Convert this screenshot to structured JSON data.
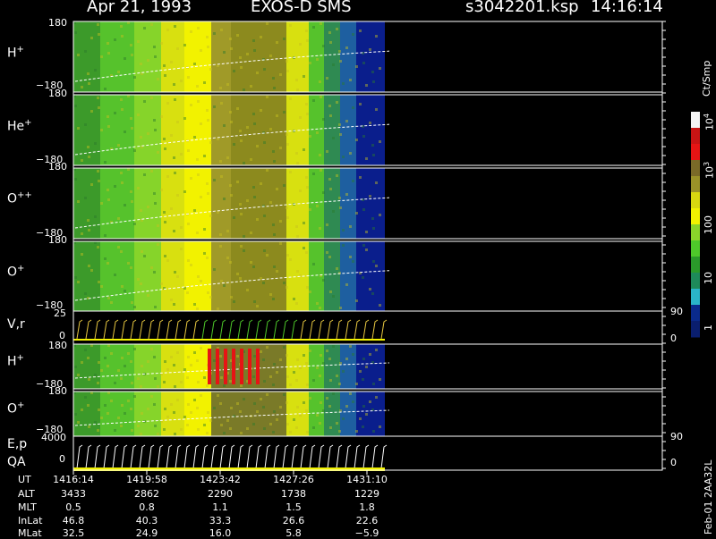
{
  "header": {
    "date": "Apr 21, 1993",
    "instrument": "EXOS-D SMS",
    "file": "s3042201.ksp",
    "time": "14:16:14"
  },
  "chart_data": {
    "type": "heatmap",
    "time_range": [
      "1416:14",
      "1431:10"
    ],
    "panels": [
      {
        "label": "H",
        "charge": "+",
        "ymax": "180",
        "ymin": "−180"
      },
      {
        "label": "He",
        "charge": "+",
        "ymax": "180",
        "ymin": "−180"
      },
      {
        "label": "O",
        "charge": "++",
        "ymax": "180",
        "ymin": "−180"
      },
      {
        "label": "O",
        "charge": "+",
        "ymax": "180",
        "ymin": "−180"
      },
      {
        "label": "V,r",
        "charge": "",
        "ymax": "25",
        "ymin": "0",
        "right_max": "90",
        "right_min": "0"
      },
      {
        "label": "H",
        "charge": "+",
        "ymax": "180",
        "ymin": "−180"
      },
      {
        "label": "O",
        "charge": "+",
        "ymax": "180",
        "ymin": "−180"
      },
      {
        "label": "E,p",
        "label2": "QA",
        "charge": "",
        "ymax": "4000",
        "ymin": "0",
        "right_max": "90",
        "right_min": "0"
      }
    ],
    "colorbar": {
      "unit": "Ct/Smp",
      "ticks": [
        "1",
        "10",
        "100",
        "10",
        "10"
      ],
      "tick_exps": [
        "",
        "",
        "",
        "3",
        "4"
      ]
    },
    "ephemeris": {
      "rows": [
        {
          "name": "UT",
          "values": [
            "1416:14",
            "1419:58",
            "1423:42",
            "1427:26",
            "1431:10"
          ]
        },
        {
          "name": "ALT",
          "values": [
            "3433",
            "2862",
            "2290",
            "1738",
            "1229"
          ]
        },
        {
          "name": "MLT",
          "values": [
            "0.5",
            "0.8",
            "1.1",
            "1.5",
            "1.8"
          ]
        },
        {
          "name": "InLat",
          "values": [
            "46.8",
            "40.3",
            "33.3",
            "26.6",
            "22.6"
          ]
        },
        {
          "name": "MLat",
          "values": [
            "32.5",
            "24.9",
            "16.0",
            "5.8",
            "−5.9"
          ]
        }
      ]
    }
  },
  "footer_stamp": "Feb-01 2AA32L",
  "colors": {
    "yellow": "#f2f200",
    "olive": "#8c8a1e",
    "green": "#4ec82a",
    "blue": "#0a1e8c",
    "red": "#e61414"
  }
}
